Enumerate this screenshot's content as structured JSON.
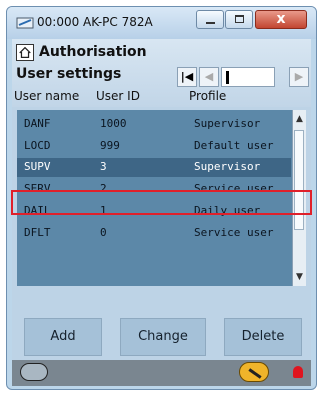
{
  "window": {
    "title": "00:000 AK-PC 782A",
    "close_label": "x"
  },
  "header": {
    "title": "Authorisation",
    "subtitle": "User settings"
  },
  "columns": {
    "user_name": "User name",
    "user_id": "User ID",
    "profile": "Profile"
  },
  "users": [
    {
      "name": "DANF",
      "id": "1000",
      "profile": "Supervisor"
    },
    {
      "name": "LOCD",
      "id": "999",
      "profile": "Default user"
    },
    {
      "name": "SUPV",
      "id": "3",
      "profile": "Supervisor"
    },
    {
      "name": "SERV",
      "id": "2",
      "profile": "Service user"
    },
    {
      "name": "DAIL",
      "id": "1",
      "profile": "Daily user"
    },
    {
      "name": "DFLT",
      "id": "0",
      "profile": "Service user"
    }
  ],
  "selected_index": 2,
  "buttons": {
    "add": "Add",
    "change": "Change",
    "delete": "Delete"
  },
  "colors": {
    "accent": "#3e6686",
    "highlight": "#e0202a",
    "list_bg": "#5c88a8"
  },
  "icons": {
    "app": "network-icon",
    "home": "home-icon",
    "status_left": "glasses-icon",
    "status_mid": "wrench-icon",
    "status_right": "alarm-bell-icon"
  }
}
